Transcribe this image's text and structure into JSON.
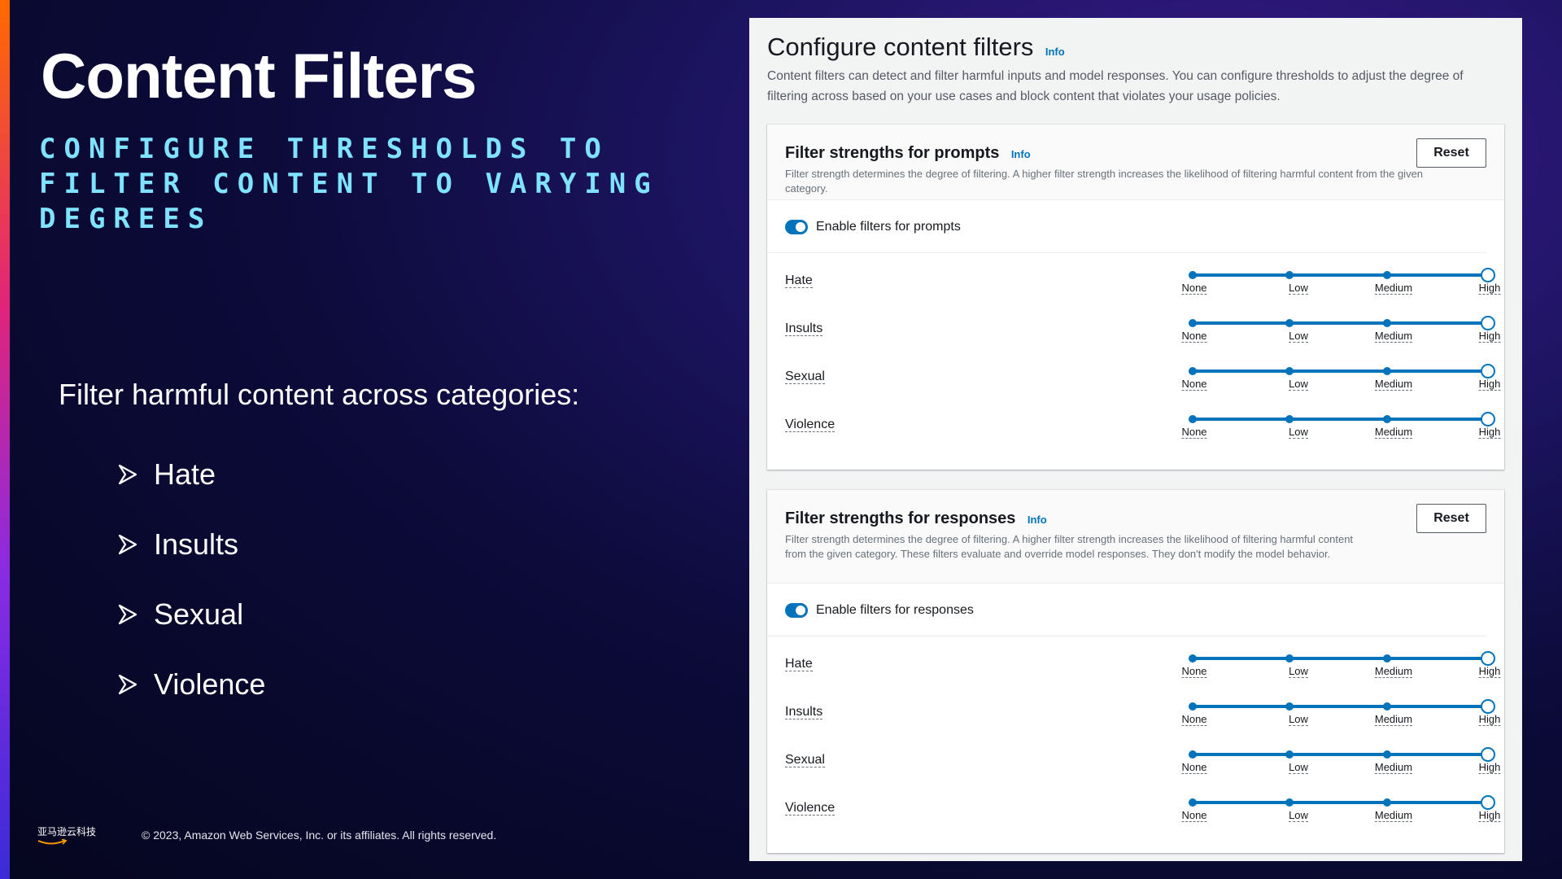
{
  "slide": {
    "title": "Content Filters",
    "subtitle": "CONFIGURE THRESHOLDS TO FILTER CONTENT TO VARYING DEGREES",
    "lead": "Filter harmful content across categories:",
    "categories": [
      "Hate",
      "Insults",
      "Sexual",
      "Violence"
    ],
    "logo_text": "亚马逊云科技",
    "copyright": "© 2023, Amazon Web Services, Inc. or its affiliates. All rights reserved.",
    "colors": {
      "accent_cyan": "#7fe3ff",
      "aws_blue": "#0073bb"
    }
  },
  "console": {
    "title": "Configure content filters",
    "info": "Info",
    "description": "Content filters can detect and filter harmful inputs and model responses. You can configure thresholds to adjust the degree of filtering across based on your use cases and block content that violates your usage policies.",
    "prompts": {
      "title": "Filter strengths for prompts",
      "info": "Info",
      "description": "Filter strength determines the degree of filtering.  A higher filter strength increases the likelihood of filtering harmful content from the given category.",
      "reset": "Reset",
      "toggle_label": "Enable filters for prompts",
      "enabled": true,
      "filters": [
        {
          "label": "Hate",
          "level": "High"
        },
        {
          "label": "Insults",
          "level": "High"
        },
        {
          "label": "Sexual",
          "level": "High"
        },
        {
          "label": "Violence",
          "level": "High"
        }
      ]
    },
    "responses": {
      "title": "Filter strengths for responses",
      "info": "Info",
      "description": "Filter strength determines the degree of filtering.  A higher filter strength increases the likelihood of filtering harmful content from the given category. These filters evaluate and override model responses. They don't modify the model behavior.",
      "reset": "Reset",
      "toggle_label": "Enable filters for responses",
      "enabled": true,
      "filters": [
        {
          "label": "Hate",
          "level": "High"
        },
        {
          "label": "Insults",
          "level": "High"
        },
        {
          "label": "Sexual",
          "level": "High"
        },
        {
          "label": "Violence",
          "level": "High"
        }
      ]
    },
    "levels": [
      "None",
      "Low",
      "Medium",
      "High"
    ]
  }
}
